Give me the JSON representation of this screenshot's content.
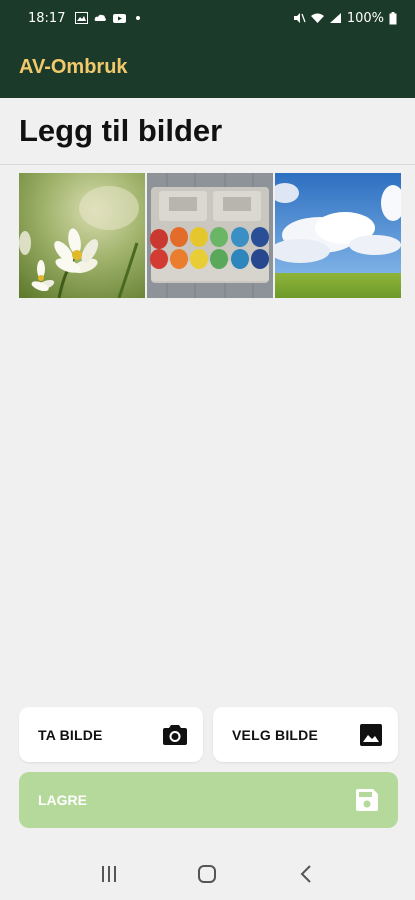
{
  "status_bar": {
    "time": "18:17",
    "battery": "100%"
  },
  "app_bar": {
    "title": "AV-Ombruk"
  },
  "page": {
    "heading": "Legg til bilder"
  },
  "gallery": {
    "images": [
      {
        "icon": "flower-photo"
      },
      {
        "icon": "easter-eggs-photo"
      },
      {
        "icon": "sky-meadow-photo"
      }
    ]
  },
  "actions": {
    "take_photo_label": "TA BILDE",
    "take_photo_icon": "camera-icon",
    "pick_photo_label": "VELG BILDE",
    "pick_photo_icon": "image-icon",
    "save_label": "LAGRE",
    "save_icon": "save-icon"
  },
  "colors": {
    "app_bar": "#1c3a2a",
    "title": "#f2c96a",
    "save_button": "#b4d99a",
    "background": "#f0f0f0"
  }
}
